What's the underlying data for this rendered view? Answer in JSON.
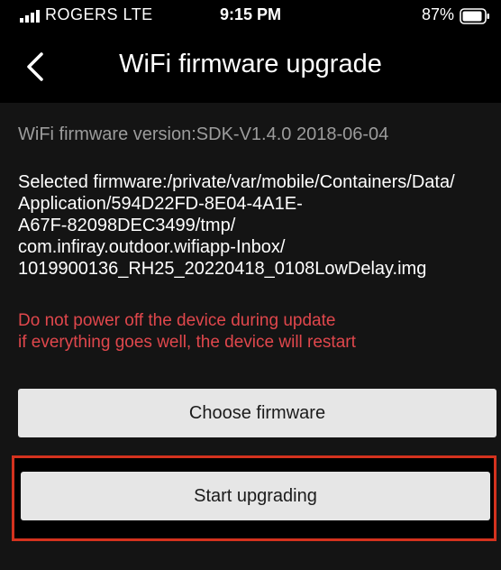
{
  "status_bar": {
    "carrier": "ROGERS  LTE",
    "time": "9:15 PM",
    "battery": "87%",
    "signal_icon": "signal-bars-icon",
    "battery_icon": "battery-icon"
  },
  "nav": {
    "title": "WiFi firmware upgrade",
    "back_icon": "chevron-left-icon"
  },
  "content": {
    "version": "WiFi firmware version:SDK-V1.4.0 2018-06-04",
    "selected_firmware": "Selected firmware:/private/var/mobile/Containers/Data/\nApplication/594D22FD-8E04-4A1E-\nA67F-82098DEC3499/tmp/\ncom.infiray.outdoor.wifiapp-Inbox/\n1019900136_RH25_20220418_0108LowDelay.img",
    "warning": "Do not power off the device during update\nif everything goes well, the device will restart",
    "choose_label": "Choose firmware",
    "start_label": "Start upgrading"
  },
  "colors": {
    "background": "#000000",
    "panel": "#141414",
    "button": "#e6e6e6",
    "warning": "#e0474c",
    "highlight": "#d4321e",
    "muted_text": "#9c9c9c"
  }
}
